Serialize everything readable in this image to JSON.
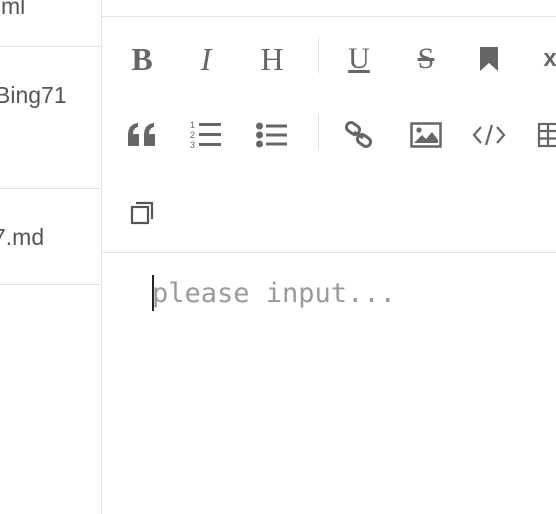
{
  "sidebar": {
    "files": [
      {
        "label": "ml"
      },
      {
        "label": "Bing71"
      },
      {
        "label": "7.md"
      }
    ]
  },
  "toolbar": {
    "row1": [
      {
        "name": "bold",
        "glyph": "B"
      },
      {
        "name": "italic",
        "glyph": "I"
      },
      {
        "name": "heading",
        "glyph": "H"
      },
      {
        "name": "underline",
        "glyph": "U"
      },
      {
        "name": "strikethrough",
        "glyph": "S"
      },
      {
        "name": "bookmark",
        "icon": "bookmark-icon"
      },
      {
        "name": "clear-format",
        "glyph": "x"
      }
    ],
    "row2": [
      {
        "name": "quote",
        "icon": "quote-icon"
      },
      {
        "name": "ordered-list",
        "icon": "ordered-list-icon"
      },
      {
        "name": "unordered-list",
        "icon": "unordered-list-icon"
      },
      {
        "name": "link",
        "icon": "link-icon"
      },
      {
        "name": "image",
        "icon": "image-icon"
      },
      {
        "name": "code",
        "icon": "code-icon"
      },
      {
        "name": "table",
        "icon": "table-icon"
      }
    ],
    "row3": [
      {
        "name": "fullscreen",
        "icon": "fullscreen-icon"
      }
    ]
  },
  "editor": {
    "placeholder": "please input...",
    "value": ""
  }
}
